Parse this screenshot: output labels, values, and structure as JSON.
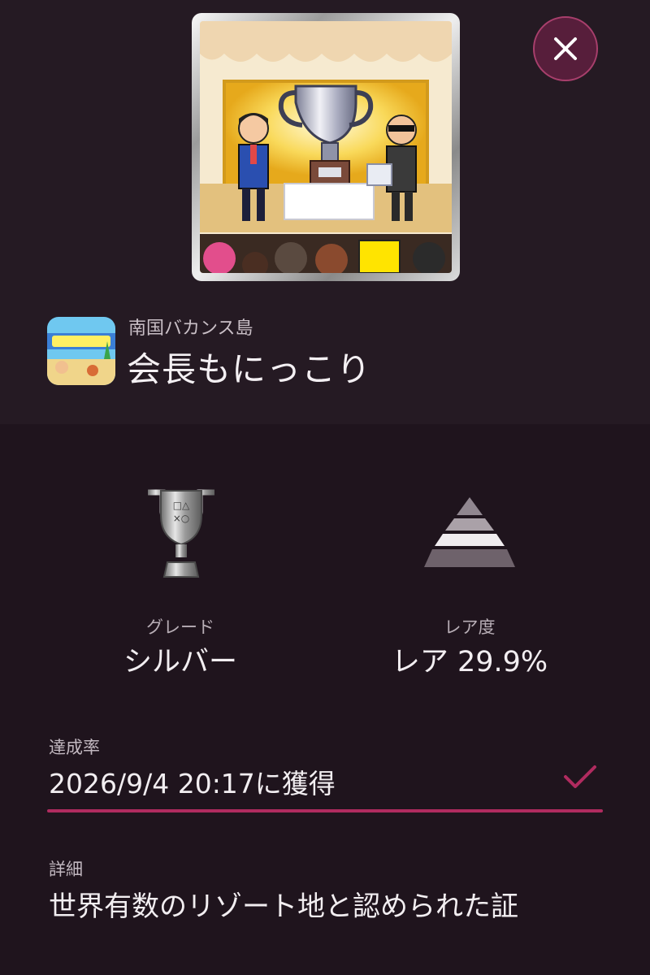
{
  "trophy": {
    "image_icon": "trophy-ceremony-art",
    "game_name": "南国バカンス島",
    "game_icon": "game-icon-vacation-island",
    "name": "会長もにっこり"
  },
  "close_icon": "close-icon",
  "stats": {
    "grade_label": "グレード",
    "grade_value": "シルバー",
    "grade_icon": "silver-trophy-icon",
    "rarity_label": "レア度",
    "rarity_value": "レア 29.9%",
    "rarity_icon": "rarity-pyramid-icon"
  },
  "achievement": {
    "label": "達成率",
    "earned": "2026/9/4  20:17に獲得",
    "check_icon": "check-icon"
  },
  "detail": {
    "label": "詳細",
    "text": "世界有数のリゾート地と認められた証"
  },
  "colors": {
    "background": "#1f141d",
    "panel": "#251a23",
    "accent": "#b02b5f",
    "close_bg": "#571e3b"
  }
}
